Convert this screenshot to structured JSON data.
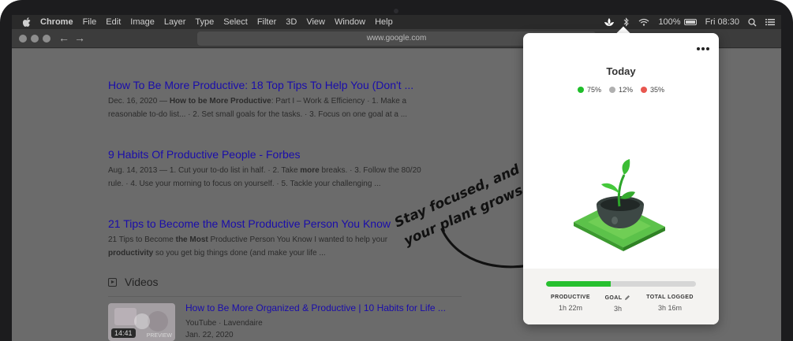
{
  "menubar": {
    "apple_icon": "apple-icon",
    "items": [
      "Chrome",
      "File",
      "Edit",
      "Image",
      "Layer",
      "Type",
      "Select",
      "Filter",
      "3D",
      "View",
      "Window",
      "Help"
    ],
    "battery_percent": "100%",
    "battery_level": 1.0,
    "clock": "Fri 08:30",
    "status_icons": [
      "focus-plant-icon",
      "bluetooth-icon",
      "wifi-icon",
      "battery-icon",
      "search-icon",
      "list-icon"
    ]
  },
  "browser": {
    "url": "www.google.com",
    "nav_icons": [
      "back-arrow-icon",
      "forward-arrow-icon"
    ]
  },
  "results": [
    {
      "title": "How To Be More Productive: 18 Top Tips To Help You (Don't ...",
      "snippet_parts": [
        {
          "text": "Dec. 16, 2020 — ",
          "bold": false
        },
        {
          "text": "How to be More Productive",
          "bold": true
        },
        {
          "text": ": Part I – Work & Efficiency · 1. Make a reasonable to-do list... · 2. Set small goals for the tasks. · 3. Focus on one goal at a ...",
          "bold": false
        }
      ]
    },
    {
      "title": "9 Habits Of Productive People - Forbes",
      "snippet_parts": [
        {
          "text": "Aug. 14, 2013 — 1. Cut your to-do list in half. · 2. Take ",
          "bold": false
        },
        {
          "text": "more",
          "bold": true
        },
        {
          "text": " breaks. · 3. Follow the 80/20 rule. · 4. Use your morning to focus on yourself. · 5. Tackle your challenging ...",
          "bold": false
        }
      ]
    },
    {
      "title": "21 Tips to Become the Most Productive Person You Know",
      "snippet_parts": [
        {
          "text": "21 Tips to Become ",
          "bold": false
        },
        {
          "text": "the Most",
          "bold": true
        },
        {
          "text": " Productive Person You Know I wanted to help your ",
          "bold": false
        },
        {
          "text": "productivity",
          "bold": true
        },
        {
          "text": " so you get big things done (and make your life ...",
          "bold": false
        }
      ]
    }
  ],
  "videos": {
    "heading": "Videos",
    "items": [
      {
        "title": "How to Be More Organized & Productive | 10 Habits for Life ...",
        "source": "YouTube",
        "channel": "Lavendaire",
        "date": "Jan. 22, 2020",
        "duration": "14:41",
        "preview_label": "PREVIEW"
      }
    ]
  },
  "annotation": {
    "line1": "Stay focused, and",
    "line2": "your plant grows"
  },
  "widget": {
    "title": "Today",
    "legend": [
      {
        "value": "75%",
        "color": "#1fbe2a"
      },
      {
        "value": "12%",
        "color": "#b0b0b0"
      },
      {
        "value": "35%",
        "color": "#e8574f"
      }
    ],
    "progress_fraction": 0.43,
    "stats": [
      {
        "label": "PRODUCTIVE",
        "value": "1h 22m"
      },
      {
        "label": "GOAL",
        "value": "3h"
      },
      {
        "label": "TOTAL LOGGED",
        "value": "3h 16m"
      }
    ]
  },
  "colors": {
    "accent_green": "#27c02f",
    "link_blue": "#1a0dab"
  }
}
